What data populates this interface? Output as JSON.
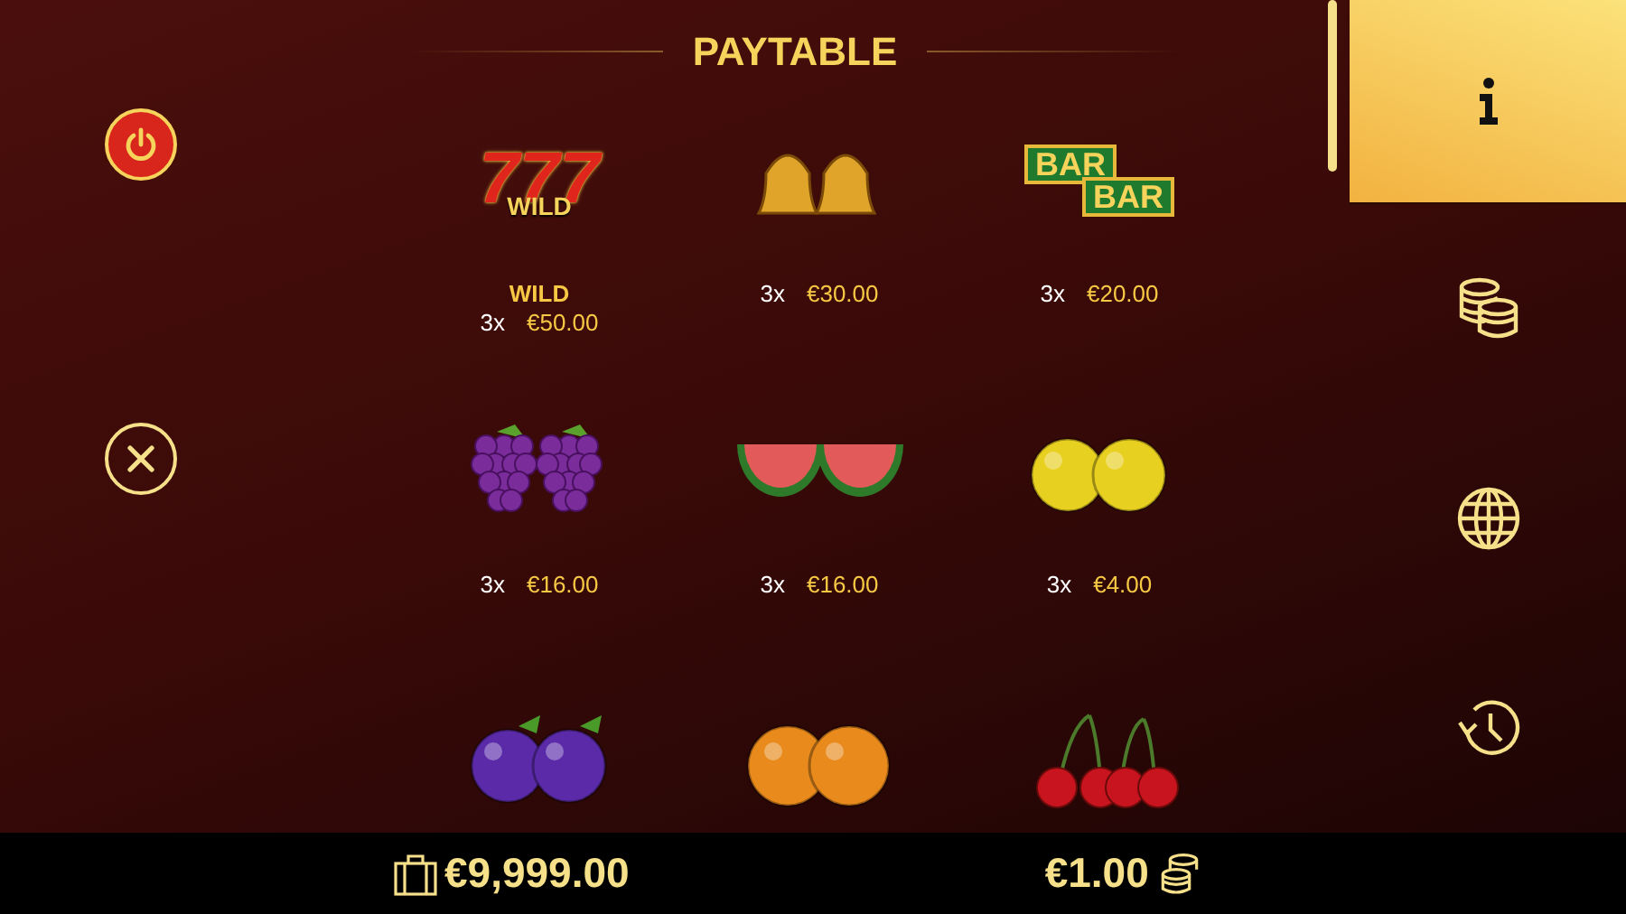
{
  "title": "PAYTABLE",
  "symbols": [
    {
      "kind": "wild",
      "label": "WILD",
      "art_text": [
        "777",
        "WILD"
      ],
      "count": "3x",
      "payout": "€50.00"
    },
    {
      "kind": "bells",
      "count": "3x",
      "payout": "€30.00"
    },
    {
      "kind": "bar",
      "art_text": [
        "BAR",
        "BAR"
      ],
      "count": "3x",
      "payout": "€20.00"
    },
    {
      "kind": "grapes",
      "count": "3x",
      "payout": "€16.00"
    },
    {
      "kind": "watermelon",
      "count": "3x",
      "payout": "€16.00"
    },
    {
      "kind": "lemon",
      "count": "3x",
      "payout": "€4.00"
    },
    {
      "kind": "plum"
    },
    {
      "kind": "orange"
    },
    {
      "kind": "cherry"
    }
  ],
  "left_buttons": [
    {
      "kind": "power"
    },
    {
      "kind": "close"
    }
  ],
  "side_menu": [
    {
      "kind": "info",
      "selected": true
    },
    {
      "kind": "coins",
      "selected": false
    },
    {
      "kind": "globe",
      "selected": false
    },
    {
      "kind": "history",
      "selected": false
    }
  ],
  "footer": {
    "balance": "€9,999.00",
    "bet": "€1.00"
  }
}
